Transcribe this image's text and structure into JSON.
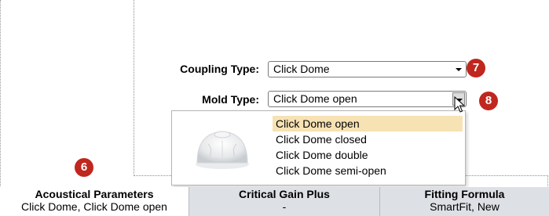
{
  "form": {
    "coupling_type": {
      "label": "Coupling Type:",
      "value": "Click Dome"
    },
    "mold_type": {
      "label": "Mold Type:",
      "value": "Click Dome open"
    }
  },
  "badges": {
    "coupling": "7",
    "mold": "8",
    "acoustical": "6"
  },
  "dropdown": {
    "options": [
      "Click Dome open",
      "Click Dome closed",
      "Click Dome double",
      "Click Dome semi-open"
    ],
    "selected": "Click Dome open"
  },
  "bottom_strip": {
    "acoustical": {
      "title": "Acoustical Parameters",
      "value": "Click Dome, Click Dome open"
    },
    "critical_gain": {
      "title": "Critical Gain Plus",
      "value": "-"
    },
    "fitting_formula": {
      "title": "Fitting Formula",
      "value": "SmartFit, New"
    }
  },
  "colors": {
    "badge": "#c0271e",
    "selection": "#f7e2b4",
    "strip": "#dde0e4"
  },
  "icons": {
    "dropdown_preview": "click-dome-image",
    "pointer": "mouse-cursor-icon"
  }
}
